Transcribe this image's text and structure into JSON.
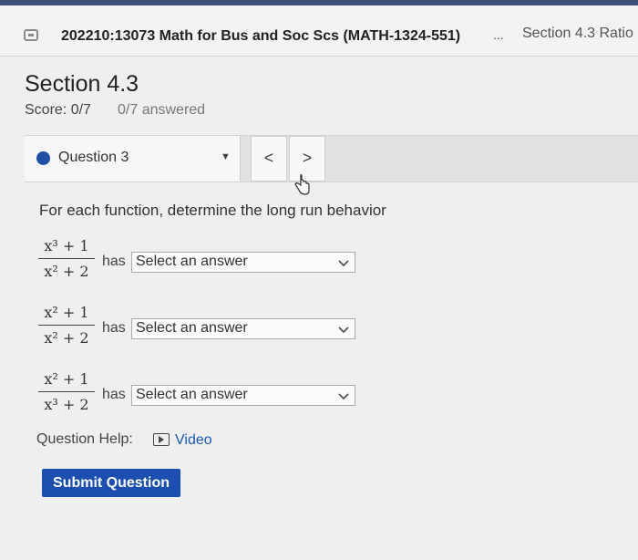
{
  "tab_bar": {
    "course_title": "202210:13073 Math for Bus and Soc Scs (MATH-1324-551)",
    "ellipsis": "...",
    "section_tab": "Section 4.3 Ratio"
  },
  "header": {
    "section_title": "Section 4.3",
    "score": "Score: 0/7",
    "answered": "0/7 answered"
  },
  "question_nav": {
    "current": "Question 3",
    "prev": "<",
    "next": ">"
  },
  "question": {
    "prompt": "For each function, determine the long run behavior",
    "connector": "has",
    "rows": [
      {
        "numerator": "x³ + 1",
        "denominator": "x² + 2",
        "answer": "Select an answer"
      },
      {
        "numerator": "x² + 1",
        "denominator": "x² + 2",
        "answer": "Select an answer"
      },
      {
        "numerator": "x² + 1",
        "denominator": "x³ + 2",
        "answer": "Select an answer"
      }
    ]
  },
  "help": {
    "label": "Question Help:",
    "video_link": "Video"
  },
  "submit_label": "Submit Question",
  "colors": {
    "accent": "#1c4fb0",
    "link": "#1f58b8",
    "question_dot": "#1d4fa3"
  }
}
